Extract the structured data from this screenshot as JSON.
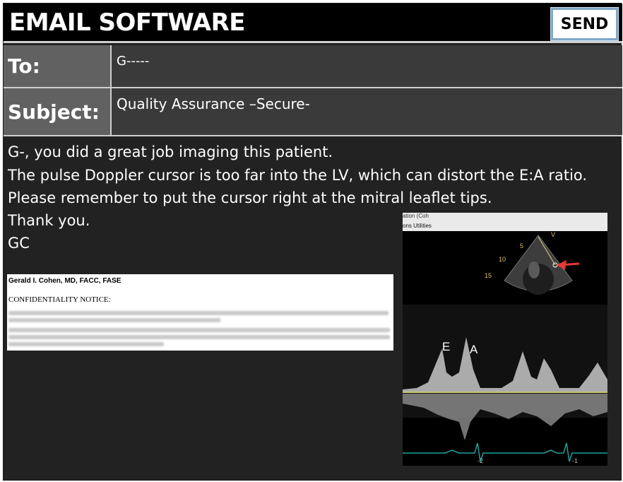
{
  "app": {
    "title": "EMAIL SOFTWARE"
  },
  "toolbar": {
    "send_label": "SEND"
  },
  "header": {
    "to": {
      "label": "To:",
      "value": "G-----"
    },
    "subject": {
      "label": "Subject:",
      "value": "Quality Assurance –Secure-"
    }
  },
  "message": {
    "lines": [
      "G-, you did a great job imaging  this patient.",
      "The pulse Doppler cursor is too far into the LV, which can distort the E:A ratio.",
      "Please remember to put the cursor right at the mitral leaflet tips.",
      "Thank you.",
      "GC"
    ]
  },
  "signature": {
    "name": "Gerald I. Cohen, MD, FACC, FASE",
    "notice": "CONFIDENTIALITY NOTICE:"
  },
  "echo_image": {
    "window_title": "ation (Coh",
    "menu": "ons  Utilities",
    "depth_labels": [
      "5",
      "10",
      "15"
    ],
    "marker": "V",
    "wave_labels": [
      "E",
      "A"
    ],
    "ecg_labels": [
      "-2",
      "-1"
    ],
    "arrow_color": "#e53935",
    "ecg_color": "#1aa39a"
  }
}
